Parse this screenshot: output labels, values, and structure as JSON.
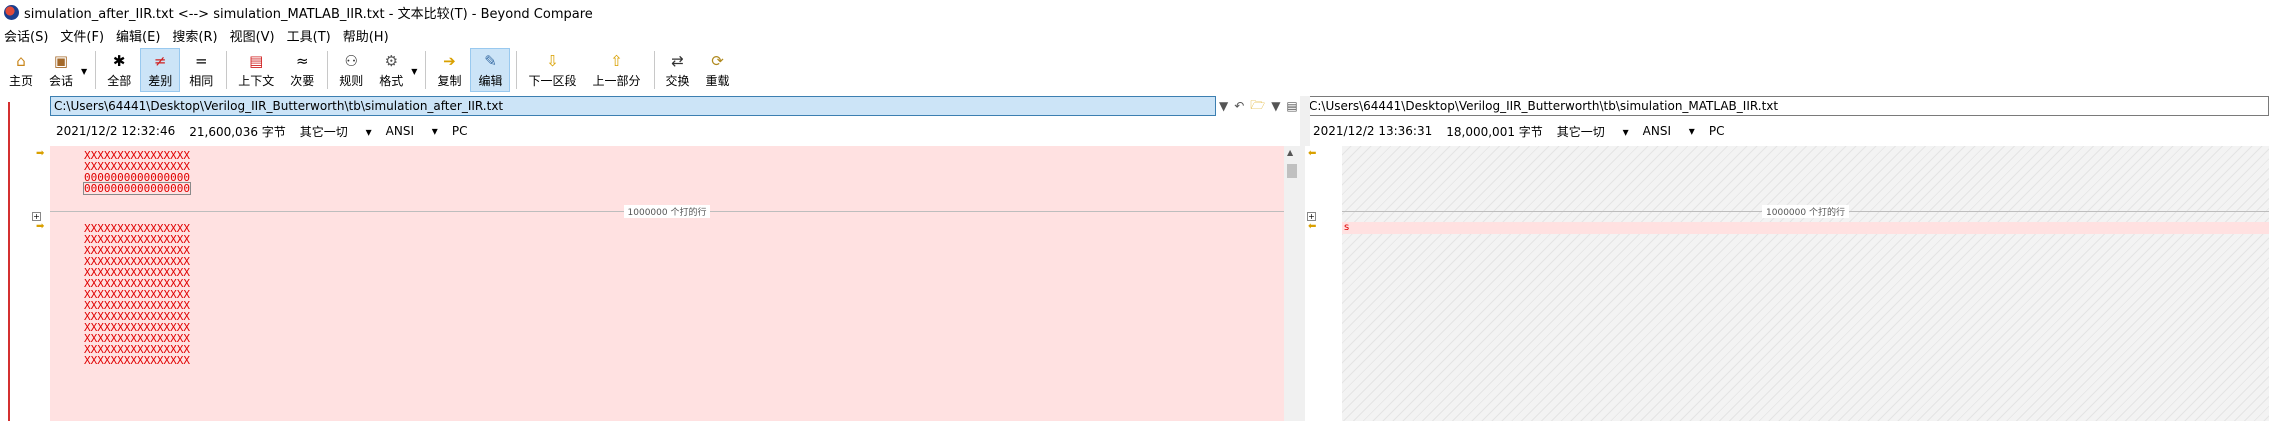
{
  "window": {
    "title": "simulation_after_IIR.txt <--> simulation_MATLAB_IIR.txt - 文本比较(T) - Beyond Compare"
  },
  "menu": [
    "会话(S)",
    "文件(F)",
    "编辑(E)",
    "搜索(R)",
    "视图(V)",
    "工具(T)",
    "帮助(H)"
  ],
  "toolbar": {
    "home": "主页",
    "session": "会话",
    "all": "全部",
    "diffs": "差别",
    "same": "相同",
    "context": "上下文",
    "minor": "次要",
    "rules": "规则",
    "format": "格式",
    "copy": "复制",
    "edit": "编辑",
    "next_section": "下一区段",
    "prev_section": "上一部分",
    "swap": "交换",
    "reload": "重载"
  },
  "left": {
    "path": "C:\\Users\\64441\\Desktop\\Verilog_IIR_Butterworth\\tb\\simulation_after_IIR.txt",
    "date": "2021/12/2 12:32:46",
    "size": "21,600,036 字节",
    "filter": "其它一切",
    "encoding": "ANSI",
    "line_end": "PC",
    "lines_top": [
      "XXXXXXXXXXXXXXXX",
      "XXXXXXXXXXXXXXXX",
      "0000000000000000",
      "0000000000000000"
    ],
    "gap_text": "1000000 个打的行",
    "lines_bottom": [
      "XXXXXXXXXXXXXXXX",
      "XXXXXXXXXXXXXXXX",
      "XXXXXXXXXXXXXXXX",
      "XXXXXXXXXXXXXXXX",
      "XXXXXXXXXXXXXXXX",
      "XXXXXXXXXXXXXXXX",
      "XXXXXXXXXXXXXXXX",
      "XXXXXXXXXXXXXXXX",
      "XXXXXXXXXXXXXXXX",
      "XXXXXXXXXXXXXXXX",
      "XXXXXXXXXXXXXXXX",
      "XXXXXXXXXXXXXXXX",
      "XXXXXXXXXXXXXXXX"
    ]
  },
  "right": {
    "path": "C:\\Users\\64441\\Desktop\\Verilog_IIR_Butterworth\\tb\\simulation_MATLAB_IIR.txt",
    "date": "2021/12/2 13:36:31",
    "size": "18,000,001 字节",
    "filter": "其它一切",
    "encoding": "ANSI",
    "line_end": "PC",
    "gap_text": "1000000 个打的行",
    "diff_glyph": "s"
  },
  "icons": {
    "home": "house-icon",
    "session": "briefcase-icon",
    "all": "asterisk-icon",
    "diffs": "not-equal-icon",
    "same": "equal-icon",
    "context": "context-icon",
    "minor": "approx-icon",
    "rules": "referee-icon",
    "format": "gear-icon",
    "copy": "arrow-right-icon",
    "edit": "pencil-icon",
    "next": "arrow-down-icon",
    "prev": "arrow-up-icon",
    "swap": "swap-icon",
    "reload": "reload-icon"
  }
}
